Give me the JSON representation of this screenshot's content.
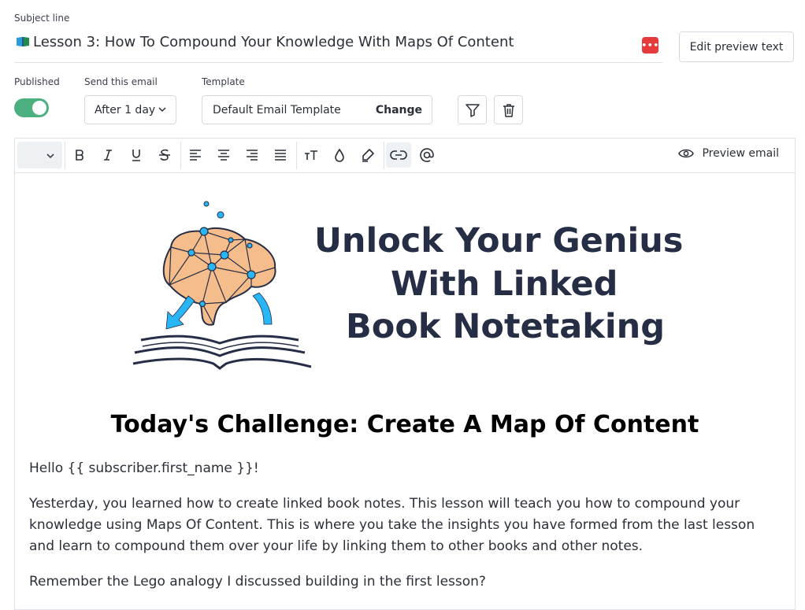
{
  "subject": {
    "label": "Subject line",
    "value": "Lesson 3: How To Compound Your Knowledge With Maps Of Content",
    "dots": "•••"
  },
  "edit_preview_text_label": "Edit preview text",
  "published": {
    "label": "Published",
    "on": true
  },
  "send": {
    "label": "Send this email",
    "value": "After 1 day"
  },
  "template": {
    "label": "Template",
    "value": "Default Email Template",
    "change_label": "Change"
  },
  "toolbar": {
    "buttons": [
      "bold-icon",
      "italic-icon",
      "underline-icon",
      "strikethrough-icon",
      "align-left-icon",
      "align-center-icon",
      "align-right-icon",
      "align-justify-icon",
      "font-size-icon",
      "color-drop-icon",
      "highlighter-icon",
      "link-icon",
      "mention-icon"
    ],
    "preview_email_label": "Preview email"
  },
  "banner": {
    "line1": "Unlock Your Genius",
    "line2": "With Linked",
    "line3": "Book Notetaking",
    "colors": {
      "brain": "#f6bd8c",
      "nodes": "#29b6f6",
      "text": "#262e45",
      "arrows": "#29b6f6"
    }
  },
  "body": {
    "title": "Today's Challenge: Create A Map Of Content",
    "hello": "Hello {{ subscriber.first_name }}!",
    "yesterday": "Yesterday, you learned how to create linked book notes. This lesson will teach you how to compound your knowledge using Maps Of Content. This is where you take the insights you have formed from the last lesson and learn to compound them over your life by linking them to other books and other notes.",
    "remember": "Remember the Lego analogy I discussed building in the first lesson?"
  }
}
